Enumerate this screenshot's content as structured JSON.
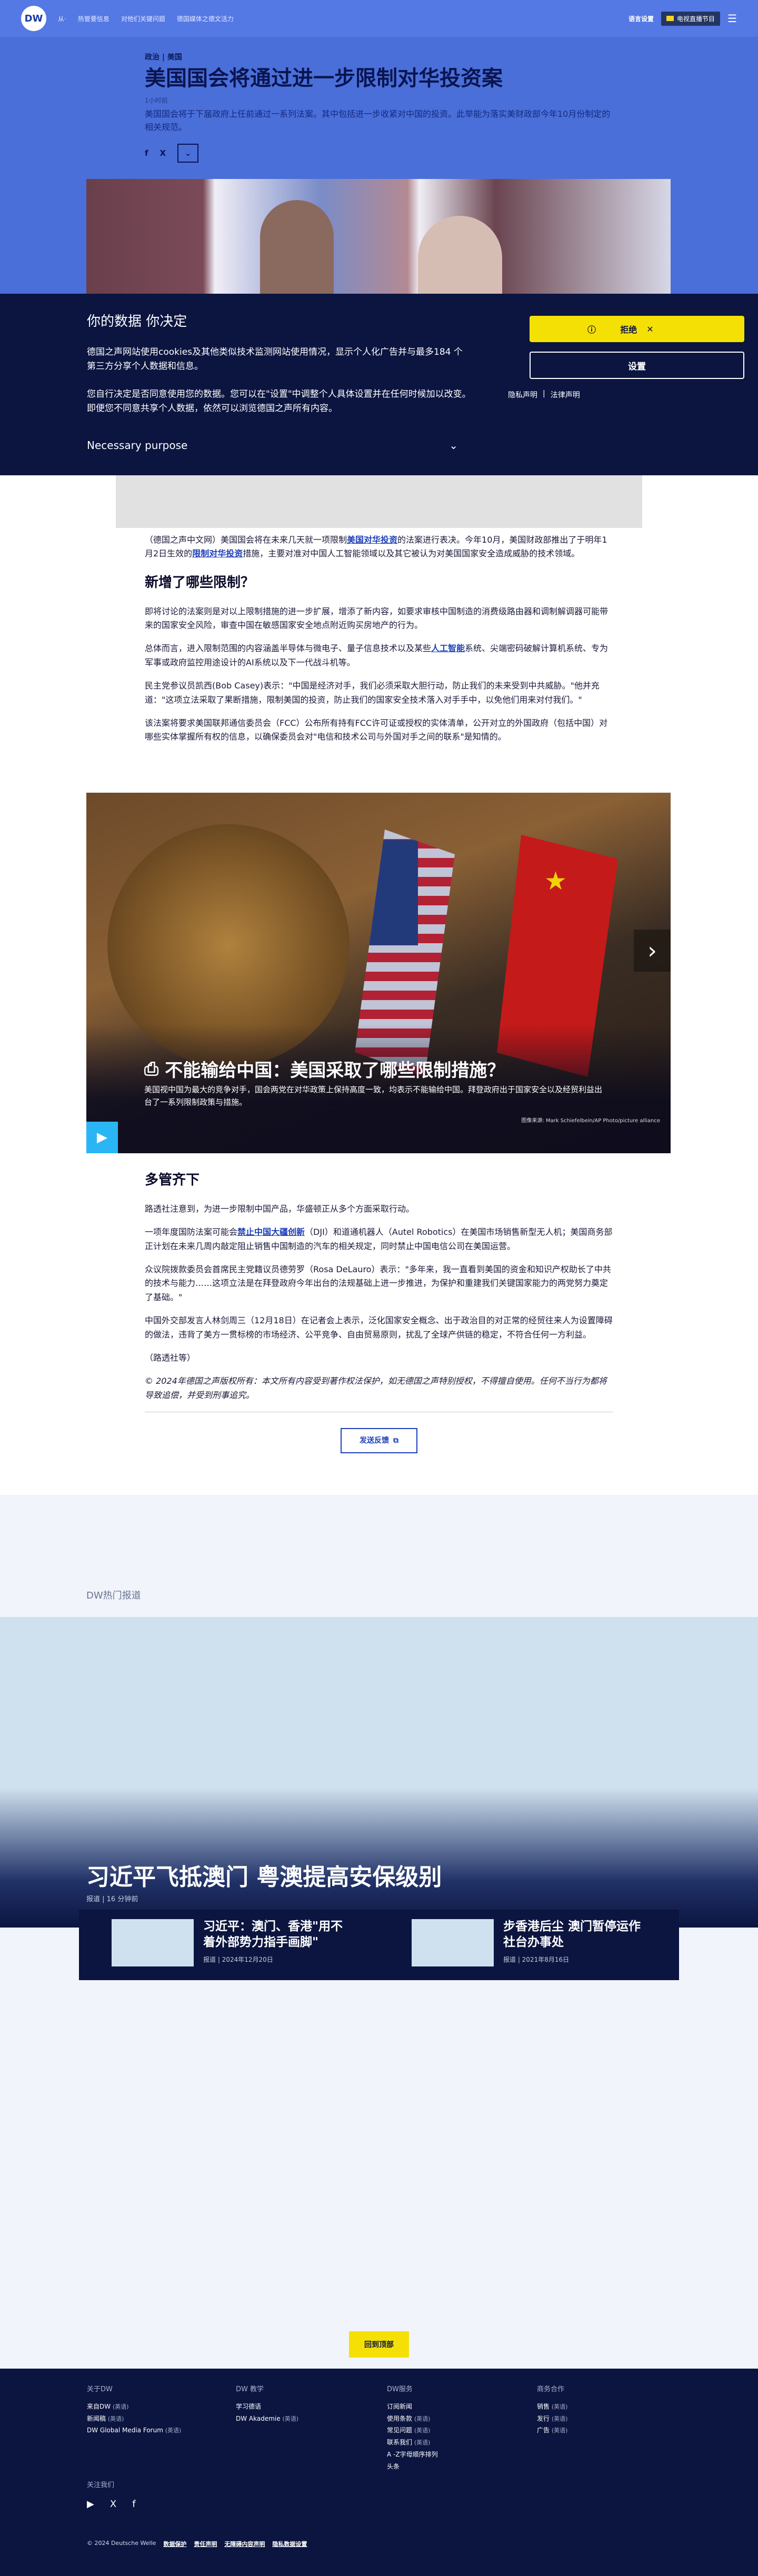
{
  "nav": {
    "logo": "DW",
    "links": [
      "从·",
      "热管要信息",
      "对他们关键问题",
      "德国媒体之德文活力"
    ],
    "lang": "语言设置",
    "live": "电视直播节目",
    "menu_icon": "menu-icon"
  },
  "article": {
    "kicker": "政治 | 美国",
    "headline": "美国国会将通过进一步限制对华投资案",
    "date": "1小时前",
    "teaser": "美国国会将于下届政府上任前通过一系列法案。其中包括进一步收紧对中国的投资。此举能为落实美财政部今年10月份制定的相关规范。",
    "share": [
      "f",
      "X",
      "⌄"
    ]
  },
  "cookie": {
    "title": "你的数据 你决定",
    "p1": "德国之声网站使用cookies及其他类似技术监测网站使用情况，显示个人化广告并与最多184 个第三方分享个人数据和信息。",
    "p2": "您自行决定是否同意使用您的数据。您可以在\"设置\"中调整个人具体设置并在任何时候加以改变。即便您不同意共享个人数据，依然可以浏览德国之声所有内容。",
    "purpose": "Necessary purpose",
    "reject": "拒绝",
    "settings": "设置",
    "privacy": "隐私声明",
    "legal": "法律声明"
  },
  "body": {
    "p1_a": "（德国之声中文网）美国国会将在未来几天就一项限制",
    "p1_link1": "美国对华投资",
    "p1_b": "的法案进行表决。今年10月，美国财政部推出了于明年1月2日生效的",
    "p1_link2": "限制对华投资",
    "p1_c": "措施，主要对准对中国人工智能领域以及其它被认为对美国国家安全造成威胁的技术领域。",
    "h1": "新增了哪些限制？",
    "p2": "即将讨论的法案则是对以上限制措施的进一步扩展，增添了新内容，如要求审核中国制造的消费级路由器和调制解调器可能带来的国家安全风险，审查中国在敏感国家安全地点附近购买房地产的行为。",
    "p3_a": "总体而言，进入限制范围的内容涵盖半导体与微电子、量子信息技术以及某些",
    "p3_link": "人工智能",
    "p3_b": "系统、尖端密码破解计算机系统、专为军事或政府监控用途设计的AI系统以及下一代战斗机等。",
    "p4": "民主党参议员凯西(Bob Casey)表示：\"中国是经济对手，我们必须采取大胆行动，防止我们的未来受到中共威胁。\"他并充道：\"这项立法采取了果断措施，限制美国的投资，防止我们的国家安全技术落入对手手中，以免他们用来对付我们。\"",
    "p5": "该法案将要求美国联邦通信委员会（FCC）公布所有持有FCC许可证或授权的实体清单，公开对立的外国政府（包括中国）对哪些实体掌握所有权的信息，以确保委员会对\"电信和技术公司与外国对手之间的联系\"是知情的。"
  },
  "video": {
    "title": "不能输给中国：美国采取了哪些限制措施？",
    "text": "美国视中国为最大的竞争对手，国会两党在对华政策上保持高度一致，均表示不能输给中国。拜登政府出于国家安全以及经贸利益出台了一系列限制政策与措施。",
    "credit": "图像来源: Mark Schiefelbein/AP Photo/picture alliance",
    "play_icon": "play-icon",
    "next_icon": "chevron-right-icon"
  },
  "body2": {
    "h2": "多管齐下",
    "p1": "路透社注意到，为进一步限制中国产品，华盛顿正从多个方面采取行动。",
    "p2_a": "一项年度国防法案可能会",
    "p2_link": "禁止中国大疆创新",
    "p2_b": "（DJI）和道通机器人（Autel Robotics）在美国市场销售新型无人机；美国商务部正计划在未来几周内敲定阻止销售中国制造的汽车的相关规定，同时禁止中国电信公司在美国运营。",
    "p3": "众议院拨款委员会首席民主党籍议员德劳罗（Rosa DeLauro）表示：\"多年来，我一直看到美国的资金和知识产权助长了中共的技术与能力……这项立法是在拜登政府今年出台的法规基础上进一步推进，为保护和重建我们关键国家能力的两党努力奠定了基础。\"",
    "p4": "中国外交部发言人林剑周三（12月18日）在记者会上表示，泛化国家安全概念、出于政治目的对正常的经贸往来人为设置障碍的做法，违背了美方一贯标榜的市场经济、公平竞争、自由贸易原则，扰乱了全球产供链的稳定，不符合任何一方利益。",
    "p5": "（路透社等）",
    "copyright": "© 2024年德国之声版权所有：本文所有内容受到著作权法保护，如无德国之声特别授权，不得擅自使用。任何不当行为都将导致追偿，并受到刑事追究。",
    "feedback": "发送反馈"
  },
  "hot": {
    "label": "DW热门报道",
    "title": "习近平飞抵澳门 粤澳提高安保级别",
    "meta": "报道 | 16 分钟前",
    "cards": [
      {
        "title": "习近平：澳门、香港\"用不着外部势力指手画脚\"",
        "meta": "报道 | 2024年12月20日"
      },
      {
        "title": "步香港后尘 澳门暂停运作社台办事处",
        "meta": "报道 | 2021年8月16日"
      }
    ],
    "back_top": "回到顶部"
  },
  "footer": {
    "cols": [
      {
        "head": "关于DW",
        "items": [
          [
            "来自DW",
            "(英语)"
          ],
          [
            "新闻稿",
            "(英语)"
          ],
          [
            "DW Global Media Forum",
            "(英语)"
          ]
        ]
      },
      {
        "head": "DW 教学",
        "items": [
          [
            "学习德语",
            ""
          ],
          [
            "DW Akademie",
            "(英语)"
          ]
        ]
      },
      {
        "head": "DW服务",
        "items": [
          [
            "订阅新闻",
            ""
          ],
          [
            "使用条款",
            "(英语)"
          ],
          [
            "常见问题",
            "(英语)"
          ],
          [
            "联系我们",
            "(英语)"
          ],
          [
            "A -Z字母顺序排列",
            ""
          ],
          [
            "头条",
            ""
          ]
        ]
      },
      {
        "head": "商务合作",
        "items": [
          [
            "销售",
            "(英语)"
          ],
          [
            "发行",
            "(英语)"
          ],
          [
            "广告",
            "(英语)"
          ]
        ]
      }
    ],
    "follow": "关注我们",
    "social": [
      "▶",
      "X",
      "f"
    ],
    "bottom": {
      "copyright": "© 2024 Deutsche Welle",
      "links": [
        "数据保护",
        "责任声明",
        "无障碍内容声明",
        "隐私数据设置"
      ]
    }
  }
}
